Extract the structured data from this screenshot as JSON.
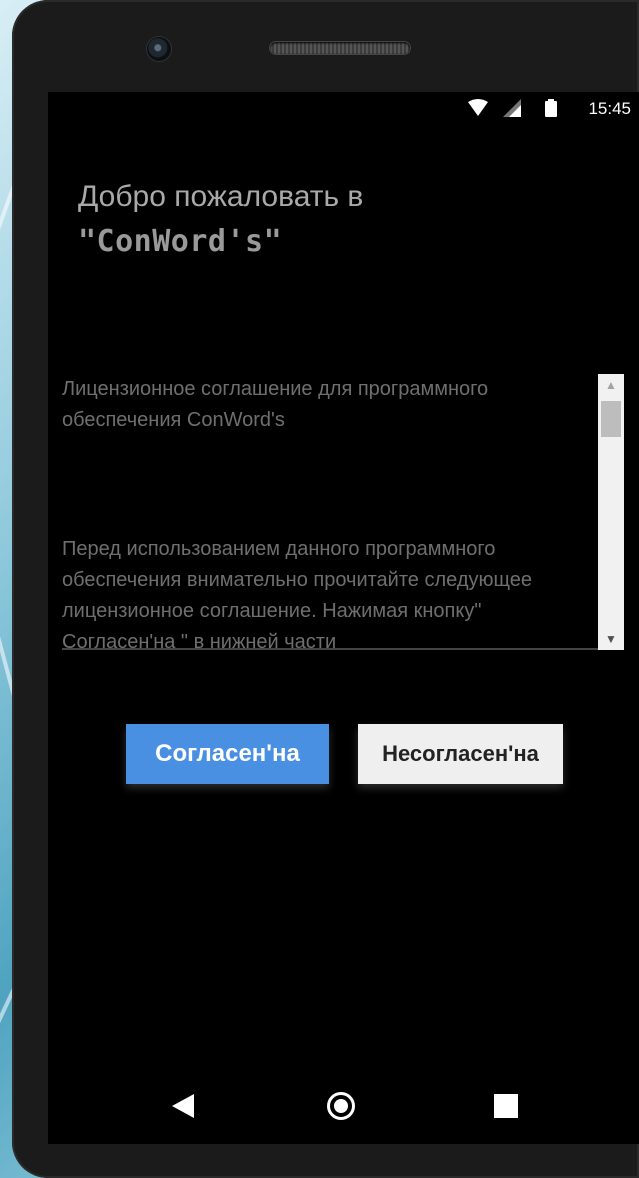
{
  "status_bar": {
    "time": "15:45",
    "icons": [
      "wifi-icon",
      "signal-icon",
      "battery-icon"
    ]
  },
  "welcome": {
    "line1": "Добро пожаловать в",
    "line2": "\"ConWord's\""
  },
  "license": {
    "title": "Лицензионное соглашение для программного обеспечения ConWord's",
    "body": "Перед использованием данного программного обеспечения внимательно прочитайте следующее лицензионное соглашение. Нажимая кнопку\" Согласен'на \" в нижней части"
  },
  "buttons": {
    "agree": "Согласен'на",
    "disagree": "Несогласен'на"
  },
  "colors": {
    "agree_button": "#4a90e2",
    "disagree_button": "#efefef",
    "screen_background": "#000000"
  },
  "navigation": [
    "back-icon",
    "home-icon",
    "recent-apps-icon"
  ]
}
